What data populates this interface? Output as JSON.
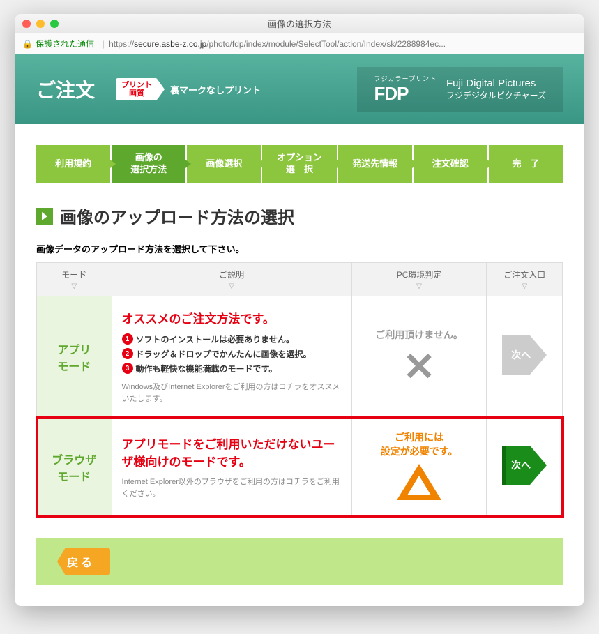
{
  "window": {
    "title": "画像の選択方法",
    "secure_label": "保護された通信",
    "url_prefix": "https://",
    "url_host": "secure.asbe-z.co.jp",
    "url_path": "/photo/fdp/index/module/SelectTool/action/Index/sk/2288984ec..."
  },
  "header": {
    "title": "ご注文",
    "print_tag_line1": "プリント",
    "print_tag_line2": "画質",
    "print_label": "裏マークなしプリント",
    "fdp_sub": "フジカラープリント",
    "fdp_main": "FDP",
    "fdp_en": "Fuji Digital Pictures",
    "fdp_jp": "フジデジタルピクチャーズ"
  },
  "steps": [
    "利用規約",
    "画像の\n選択方法",
    "画像選択",
    "オプション\n選　択",
    "発送先情報",
    "注文確認",
    "完　了"
  ],
  "section_title": "画像のアップロード方法の選択",
  "subtitle": "画像データのアップロード方法を選択して下さい。",
  "table": {
    "headers": [
      "モード",
      "ご説明",
      "PC環境判定",
      "ご注文入口"
    ],
    "rows": [
      {
        "mode": "アプリ\nモード",
        "desc_title": "オススメのご注文方法です。",
        "desc_items": [
          "ソフトのインストールは必要ありません。",
          "ドラッグ＆ドロップでかんたんに画像を選択。",
          "動作も軽快な機能満載のモードです。"
        ],
        "desc_note": "Windows及びInternet Explorerをご利用の方はコチラをオススメいたします。",
        "env_msg": "ご利用頂けません。",
        "env_icon": "x",
        "next_label": "次へ",
        "enabled": false,
        "highlight": false
      },
      {
        "mode": "ブラウザ\nモード",
        "desc_title": "アプリモードをご利用いただけないユーザ様向けのモードです。",
        "desc_items": [],
        "desc_note": "Internet Explorer以外のブラウザをご利用の方はコチラをご利用ください。",
        "env_msg": "ご利用には\n設定が必要です。",
        "env_icon": "triangle",
        "next_label": "次へ",
        "enabled": true,
        "highlight": true
      }
    ]
  },
  "back_label": "戻る"
}
